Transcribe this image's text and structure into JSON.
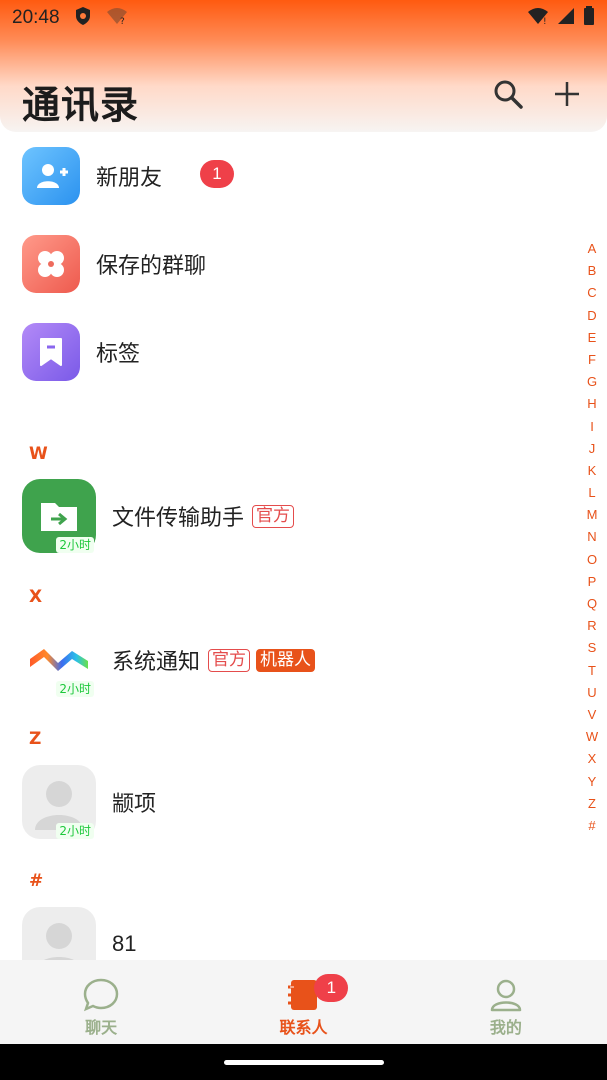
{
  "status_bar": {
    "time": "20:48"
  },
  "header": {
    "title": "通讯录"
  },
  "menu": [
    {
      "label": "新朋友",
      "badge": "1"
    },
    {
      "label": "保存的群聊"
    },
    {
      "label": "标签"
    }
  ],
  "sections": [
    {
      "letter": "W",
      "contacts": [
        {
          "name": "文件传输助手",
          "time": "2小时",
          "tags": [
            "官方"
          ]
        }
      ]
    },
    {
      "letter": "X",
      "contacts": [
        {
          "name": "系统通知",
          "time": "2小时",
          "tags": [
            "官方",
            "机器人"
          ]
        }
      ]
    },
    {
      "letter": "Z",
      "contacts": [
        {
          "name": "颛项",
          "time": "2小时"
        }
      ]
    },
    {
      "letter": "#",
      "contacts": [
        {
          "name": "81"
        }
      ]
    }
  ],
  "alphabet": [
    "A",
    "B",
    "C",
    "D",
    "E",
    "F",
    "G",
    "H",
    "I",
    "J",
    "K",
    "L",
    "M",
    "N",
    "O",
    "P",
    "Q",
    "R",
    "S",
    "T",
    "U",
    "V",
    "W",
    "X",
    "Y",
    "Z",
    "#"
  ],
  "tabbar": {
    "tabs": [
      {
        "label": "聊天",
        "icon": "chat-bubble-icon"
      },
      {
        "label": "联系人",
        "icon": "contacts-book-icon",
        "badge": "1",
        "active": true
      },
      {
        "label": "我的",
        "icon": "person-icon"
      }
    ]
  },
  "colors": {
    "accent": "#e8521a",
    "badge": "#ef4049",
    "inactive_tab": "#9bb08c"
  }
}
